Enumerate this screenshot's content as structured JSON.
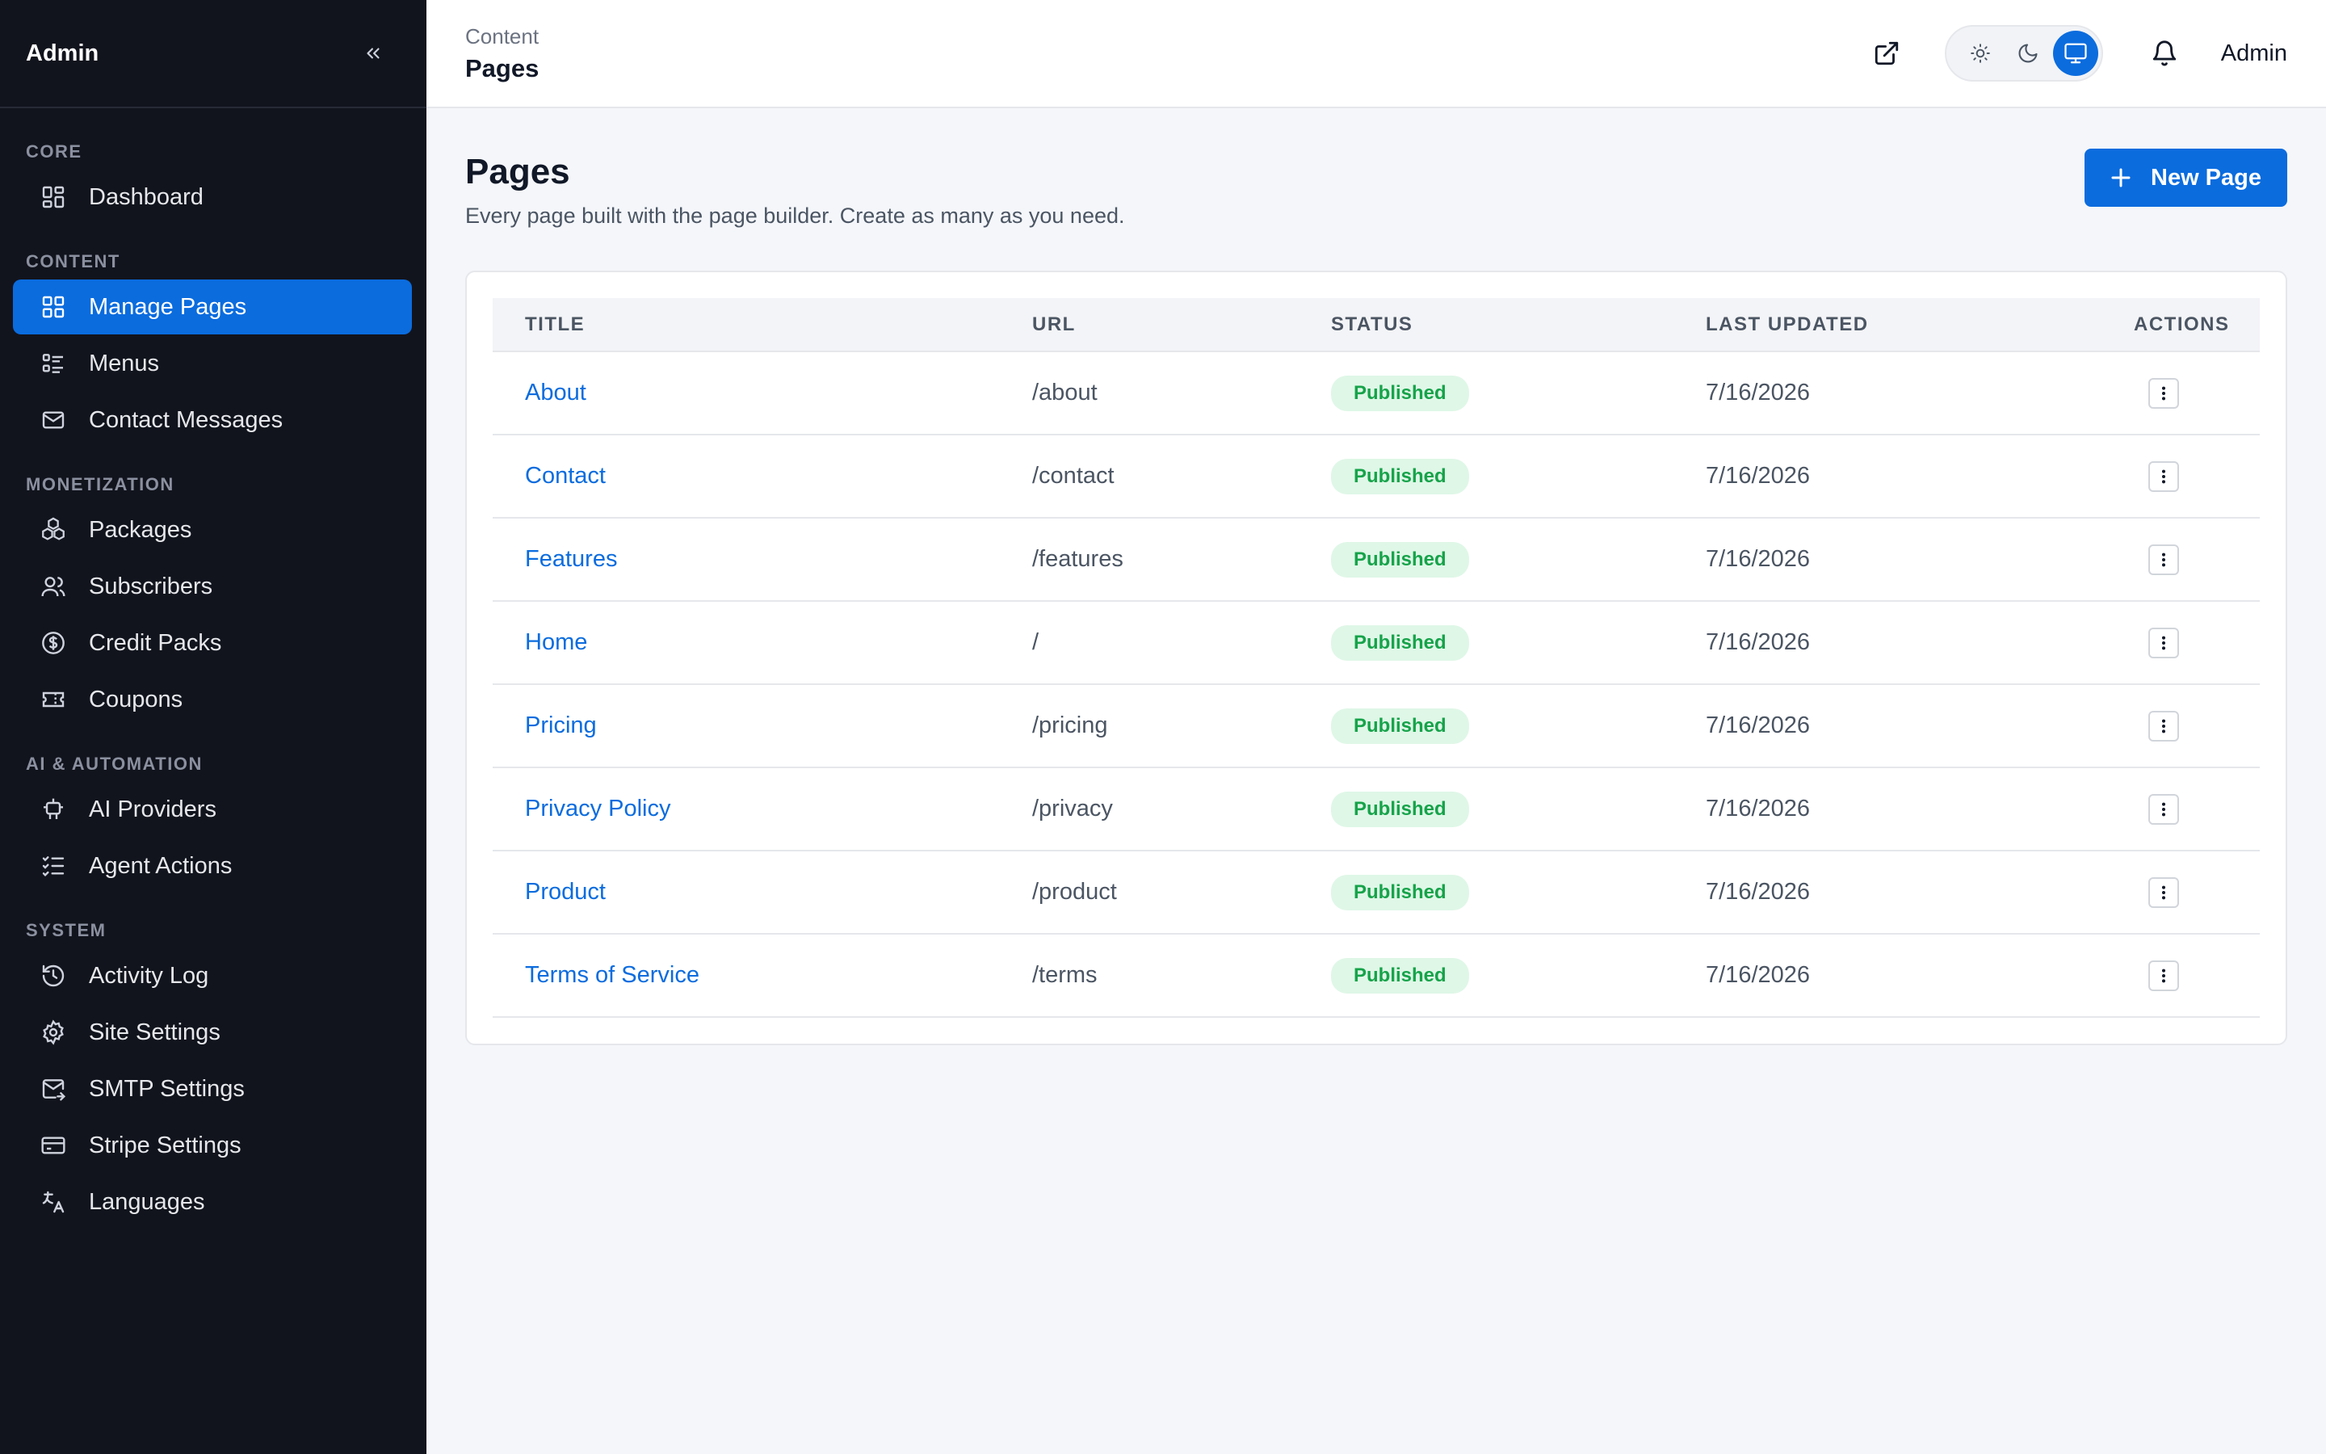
{
  "sidebar": {
    "brand": "Admin",
    "sections": [
      {
        "label": "CORE",
        "items": [
          {
            "label": "Dashboard",
            "icon": "dashboard-icon",
            "active": false
          }
        ]
      },
      {
        "label": "CONTENT",
        "items": [
          {
            "label": "Manage Pages",
            "icon": "pages-icon",
            "active": true
          },
          {
            "label": "Menus",
            "icon": "menu-list-icon",
            "active": false
          },
          {
            "label": "Contact Messages",
            "icon": "mail-icon",
            "active": false
          }
        ]
      },
      {
        "label": "MONETIZATION",
        "items": [
          {
            "label": "Packages",
            "icon": "boxes-icon",
            "active": false
          },
          {
            "label": "Subscribers",
            "icon": "users-icon",
            "active": false
          },
          {
            "label": "Credit Packs",
            "icon": "dollar-circle-icon",
            "active": false
          },
          {
            "label": "Coupons",
            "icon": "ticket-icon",
            "active": false
          }
        ]
      },
      {
        "label": "AI & AUTOMATION",
        "items": [
          {
            "label": "AI Providers",
            "icon": "robot-icon",
            "active": false
          },
          {
            "label": "Agent Actions",
            "icon": "checklist-icon",
            "active": false
          }
        ]
      },
      {
        "label": "SYSTEM",
        "items": [
          {
            "label": "Activity Log",
            "icon": "history-icon",
            "active": false
          },
          {
            "label": "Site Settings",
            "icon": "gear-icon",
            "active": false
          },
          {
            "label": "SMTP Settings",
            "icon": "mail-send-icon",
            "active": false
          },
          {
            "label": "Stripe Settings",
            "icon": "credit-card-icon",
            "active": false
          },
          {
            "label": "Languages",
            "icon": "translate-icon",
            "active": false
          }
        ]
      }
    ]
  },
  "header": {
    "breadcrumb_parent": "Content",
    "breadcrumb_current": "Pages",
    "user_name": "Admin",
    "theme_selected": "system"
  },
  "page": {
    "title": "Pages",
    "subtitle": "Every page built with the page builder. Create as many as you need.",
    "new_button": "New Page"
  },
  "table": {
    "columns": [
      "TITLE",
      "URL",
      "STATUS",
      "LAST UPDATED",
      "ACTIONS"
    ],
    "rows": [
      {
        "title": "About",
        "url": "/about",
        "status": "Published",
        "updated": "7/16/2026"
      },
      {
        "title": "Contact",
        "url": "/contact",
        "status": "Published",
        "updated": "7/16/2026"
      },
      {
        "title": "Features",
        "url": "/features",
        "status": "Published",
        "updated": "7/16/2026"
      },
      {
        "title": "Home",
        "url": "/",
        "status": "Published",
        "updated": "7/16/2026"
      },
      {
        "title": "Pricing",
        "url": "/pricing",
        "status": "Published",
        "updated": "7/16/2026"
      },
      {
        "title": "Privacy Policy",
        "url": "/privacy",
        "status": "Published",
        "updated": "7/16/2026"
      },
      {
        "title": "Product",
        "url": "/product",
        "status": "Published",
        "updated": "7/16/2026"
      },
      {
        "title": "Terms of Service",
        "url": "/terms",
        "status": "Published",
        "updated": "7/16/2026"
      }
    ]
  },
  "colors": {
    "sidebar_bg": "#12141d",
    "accent": "#0b6cde",
    "published_bg": "#dff7e7",
    "published_text": "#16a34a"
  }
}
